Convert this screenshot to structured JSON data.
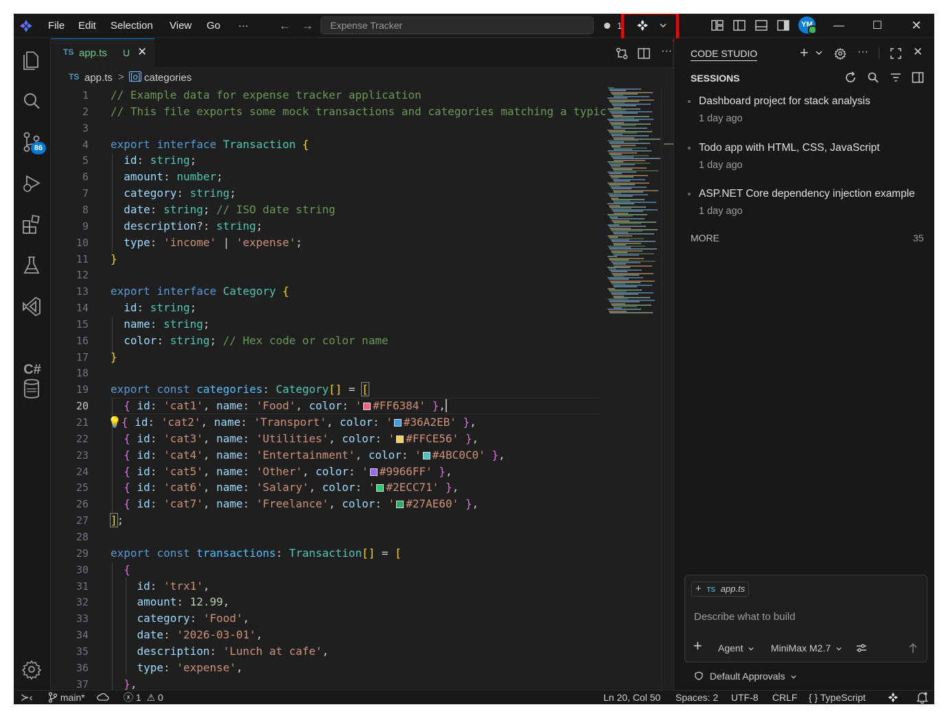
{
  "menu": [
    "File",
    "Edit",
    "Selection",
    "View",
    "Go",
    "···"
  ],
  "title_search": "Expense Tracker",
  "title_status": "1",
  "avatar_initials": "YM",
  "activity_badge": "86",
  "activity_csharp": "C#",
  "tab": {
    "lang": "TS",
    "name": "app.ts",
    "status": "U"
  },
  "breadcrumb": {
    "lang": "TS",
    "file": "app.ts",
    "separator": ">",
    "symbol": "categories"
  },
  "code_lines": [
    {
      "n": "1",
      "html": "<span class='c-com'>// Example data for expense tracker application</span>"
    },
    {
      "n": "2",
      "html": "<span class='c-com'>// This file exports some mock transactions and categories matching a typic</span>"
    },
    {
      "n": "3",
      "html": ""
    },
    {
      "n": "4",
      "html": "<span class='c-kw'>export</span> <span class='c-kw'>interface</span> <span class='c-type'>Transaction</span> <span class='c-br1'>{</span>"
    },
    {
      "n": "5",
      "html": "  <span class='c-prop'>id</span>: <span class='c-type'>string</span>;"
    },
    {
      "n": "6",
      "html": "  <span class='c-prop'>amount</span>: <span class='c-type'>number</span>;"
    },
    {
      "n": "7",
      "html": "  <span class='c-prop'>category</span>: <span class='c-type'>string</span>;"
    },
    {
      "n": "8",
      "html": "  <span class='c-prop'>date</span>: <span class='c-type'>string</span>; <span class='c-com'>// ISO date string</span>"
    },
    {
      "n": "9",
      "html": "  <span class='c-prop'>description</span>?: <span class='c-type'>string</span>;"
    },
    {
      "n": "10",
      "html": "  <span class='c-prop'>type</span>: <span class='c-str'>'income'</span> | <span class='c-str'>'expense'</span>;"
    },
    {
      "n": "11",
      "html": "<span class='c-br1'>}</span>"
    },
    {
      "n": "12",
      "html": ""
    },
    {
      "n": "13",
      "html": "<span class='c-kw'>export</span> <span class='c-kw'>interface</span> <span class='c-type'>Category</span> <span class='c-br1'>{</span>"
    },
    {
      "n": "14",
      "html": "  <span class='c-prop'>id</span>: <span class='c-type'>string</span>;"
    },
    {
      "n": "15",
      "html": "  <span class='c-prop'>name</span>: <span class='c-type'>string</span>;"
    },
    {
      "n": "16",
      "html": "  <span class='c-prop'>color</span>: <span class='c-type'>string</span>; <span class='c-com'>// Hex code or color name</span>"
    },
    {
      "n": "17",
      "html": "<span class='c-br1'>}</span>"
    },
    {
      "n": "18",
      "html": ""
    },
    {
      "n": "19",
      "html": "<span class='c-kw'>export</span> <span class='c-kw'>const</span> <span class='c-var'>categories</span>: <span class='c-type'>Category</span><span class='c-br1'>[]</span> = <span class='c-br1' style='outline:1px solid #888'>[</span>"
    },
    {
      "n": "20",
      "html": "  <span class='c-br2'>{</span> <span class='c-prop'>id</span>: <span class='c-str'>'cat1'</span>, <span class='c-prop'>name</span>: <span class='c-str'>'Food'</span>, <span class='c-prop'>color</span>: <span class='c-str'>'<span class='swatch' style='background:#FF6384'></span>#FF6384'</span> <span class='c-br2'>}</span>,<span style='border-left:2px solid #aeafad'></span>"
    },
    {
      "n": "21",
      "html": "<span style='color:#ffcc00'>💡</span><span class='c-br2'>{</span> <span class='c-prop'>id</span>: <span class='c-str'>'cat2'</span>, <span class='c-prop'>name</span>: <span class='c-str'>'Transport'</span>, <span class='c-prop'>color</span>: <span class='c-str'>'<span class='swatch' style='background:#36A2EB'></span>#36A2EB'</span> <span class='c-br2'>}</span>,"
    },
    {
      "n": "22",
      "html": "  <span class='c-br2'>{</span> <span class='c-prop'>id</span>: <span class='c-str'>'cat3'</span>, <span class='c-prop'>name</span>: <span class='c-str'>'Utilities'</span>, <span class='c-prop'>color</span>: <span class='c-str'>'<span class='swatch' style='background:#FFCE56'></span>#FFCE56'</span> <span class='c-br2'>}</span>,"
    },
    {
      "n": "23",
      "html": "  <span class='c-br2'>{</span> <span class='c-prop'>id</span>: <span class='c-str'>'cat4'</span>, <span class='c-prop'>name</span>: <span class='c-str'>'Entertainment'</span>, <span class='c-prop'>color</span>: <span class='c-str'>'<span class='swatch' style='background:#4BC0C0'></span>#4BC0C0'</span> <span class='c-br2'>}</span>,"
    },
    {
      "n": "24",
      "html": "  <span class='c-br2'>{</span> <span class='c-prop'>id</span>: <span class='c-str'>'cat5'</span>, <span class='c-prop'>name</span>: <span class='c-str'>'Other'</span>, <span class='c-prop'>color</span>: <span class='c-str'>'<span class='swatch' style='background:#9966FF'></span>#9966FF'</span> <span class='c-br2'>}</span>,"
    },
    {
      "n": "25",
      "html": "  <span class='c-br2'>{</span> <span class='c-prop'>id</span>: <span class='c-str'>'cat6'</span>, <span class='c-prop'>name</span>: <span class='c-str'>'Salary'</span>, <span class='c-prop'>color</span>: <span class='c-str'>'<span class='swatch' style='background:#2ECC71'></span>#2ECC71'</span> <span class='c-br2'>}</span>,"
    },
    {
      "n": "26",
      "html": "  <span class='c-br2'>{</span> <span class='c-prop'>id</span>: <span class='c-str'>'cat7'</span>, <span class='c-prop'>name</span>: <span class='c-str'>'Freelance'</span>, <span class='c-prop'>color</span>: <span class='c-str'>'<span class='swatch' style='background:#27AE60'></span>#27AE60'</span> <span class='c-br2'>}</span>,"
    },
    {
      "n": "27",
      "html": "<span class='c-br1' style='outline:1px solid #888'>]</span>;"
    },
    {
      "n": "28",
      "html": ""
    },
    {
      "n": "29",
      "html": "<span class='c-kw'>export</span> <span class='c-kw'>const</span> <span class='c-var'>transactions</span>: <span class='c-type'>Transaction</span><span class='c-br1'>[]</span> = <span class='c-br1'>[</span>"
    },
    {
      "n": "30",
      "html": "  <span class='c-br2'>{</span>"
    },
    {
      "n": "31",
      "html": "    <span class='c-prop'>id</span>: <span class='c-str'>'trx1'</span>,"
    },
    {
      "n": "32",
      "html": "    <span class='c-prop'>amount</span>: <span class='c-num'>12.99</span>,"
    },
    {
      "n": "33",
      "html": "    <span class='c-prop'>category</span>: <span class='c-str'>'Food'</span>,"
    },
    {
      "n": "34",
      "html": "    <span class='c-prop'>date</span>: <span class='c-str'>'2026-03-01'</span>,"
    },
    {
      "n": "35",
      "html": "    <span class='c-prop'>description</span>: <span class='c-str'>'Lunch at cafe'</span>,"
    },
    {
      "n": "36",
      "html": "    <span class='c-prop'>type</span>: <span class='c-str'>'expense'</span>,"
    },
    {
      "n": "37",
      "html": "  <span class='c-br2'>}</span>,"
    }
  ],
  "panel": {
    "title": "CODE STUDIO",
    "sessions_header": "SESSIONS",
    "sessions": [
      {
        "title": "Dashboard project for stack analysis",
        "time": "1 day ago"
      },
      {
        "title": "Todo app with HTML, CSS, JavaScript",
        "time": "1 day ago"
      },
      {
        "title": "ASP.NET Core dependency injection example",
        "time": "1 day ago"
      }
    ],
    "more_label": "MORE",
    "more_count": "35",
    "chat": {
      "attachment_lang": "TS",
      "attachment": "app.ts",
      "placeholder": "Describe what to build",
      "mode": "Agent",
      "model": "MiniMax M2.7"
    },
    "approvals": "Default Approvals"
  },
  "status": {
    "branch": "main*",
    "errors": "1",
    "warnings": "0",
    "position": "Ln 20, Col 50",
    "spaces": "Spaces: 2",
    "encoding": "UTF-8",
    "eol": "CRLF",
    "language": "TypeScript"
  }
}
